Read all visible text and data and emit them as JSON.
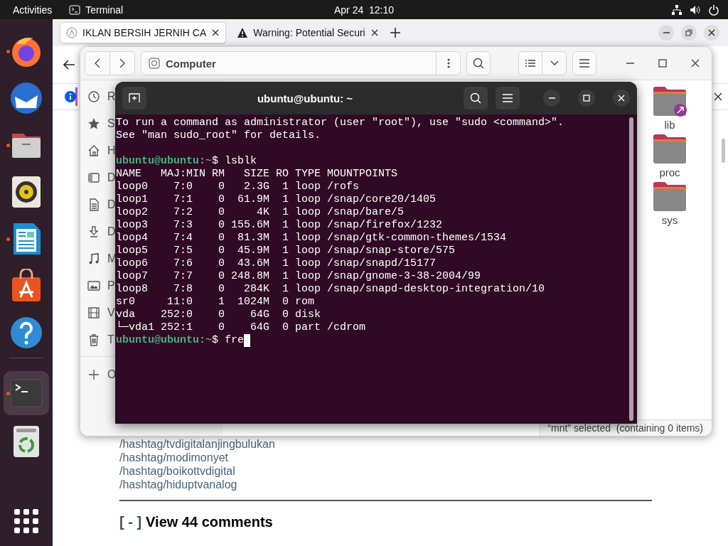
{
  "top_bar": {
    "activities": "Activities",
    "app_name": "Terminal",
    "clock": "Apr 24  12:10"
  },
  "dock": {
    "items": [
      {
        "kind": "firefox",
        "running": true,
        "selected": false
      },
      {
        "kind": "mail",
        "running": false,
        "selected": false
      },
      {
        "kind": "files",
        "running": true,
        "selected": false
      },
      {
        "kind": "music",
        "running": false,
        "selected": false
      },
      {
        "kind": "writer",
        "running": true,
        "selected": false
      },
      {
        "kind": "store",
        "running": false,
        "selected": false
      },
      {
        "kind": "help",
        "running": false,
        "selected": false
      },
      {
        "kind": "terminal",
        "running": true,
        "selected": true
      },
      {
        "kind": "trash",
        "running": false,
        "selected": false
      }
    ]
  },
  "browser": {
    "tabs": [
      {
        "title": "IKLAN BERSIH JERNIH CA",
        "kind": "page",
        "selected": true
      },
      {
        "title": "Warning: Potential Securi",
        "kind": "warning",
        "selected": false
      }
    ],
    "links": [
      "/hashtag/tvdigitalanjingbulukan",
      "/hashtag/modimonyet",
      "/hashtag/boikottvdigital",
      "/hashtag/hiduptvanalog"
    ],
    "comments_toggle": "[ - ]",
    "comments_label": "View 44 comments"
  },
  "files": {
    "location": "Computer",
    "sidebar": [
      {
        "label": "R",
        "kind": "recent"
      },
      {
        "label": "S",
        "kind": "starred"
      },
      {
        "label": "H",
        "kind": "home"
      },
      {
        "label": "D",
        "kind": "desktop"
      },
      {
        "label": "D",
        "kind": "documents"
      },
      {
        "label": "D",
        "kind": "downloads"
      },
      {
        "label": "M",
        "kind": "music"
      },
      {
        "label": "P",
        "kind": "pictures"
      },
      {
        "label": "V",
        "kind": "videos"
      },
      {
        "label": "T",
        "kind": "trash"
      },
      {
        "label": "O",
        "kind": "other"
      }
    ],
    "folders": [
      {
        "name": "lib",
        "link": true
      },
      {
        "name": "proc",
        "link": false
      },
      {
        "name": "sys",
        "link": false
      }
    ],
    "status": "“mnt” selected  (containing 0 items)"
  },
  "terminal": {
    "title": "ubuntu@ubuntu: ~",
    "lines": [
      {
        "kind": "text",
        "text": "To run a command as administrator (user \"root\"), use \"sudo <command>\"."
      },
      {
        "kind": "text",
        "text": "See \"man sudo_root\" for details."
      },
      {
        "kind": "blank"
      },
      {
        "kind": "prompt",
        "user": "ubuntu@ubuntu",
        "path": ":~",
        "command": "$ lsblk",
        "cursor": false
      },
      {
        "kind": "text",
        "text": "NAME   MAJ:MIN RM   SIZE RO TYPE MOUNTPOINTS"
      },
      {
        "kind": "text",
        "text": "loop0    7:0    0   2.3G  1 loop /rofs"
      },
      {
        "kind": "text",
        "text": "loop1    7:1    0  61.9M  1 loop /snap/core20/1405"
      },
      {
        "kind": "text",
        "text": "loop2    7:2    0     4K  1 loop /snap/bare/5"
      },
      {
        "kind": "text",
        "text": "loop3    7:3    0 155.6M  1 loop /snap/firefox/1232"
      },
      {
        "kind": "text",
        "text": "loop4    7:4    0  81.3M  1 loop /snap/gtk-common-themes/1534"
      },
      {
        "kind": "text",
        "text": "loop5    7:5    0  45.9M  1 loop /snap/snap-store/575"
      },
      {
        "kind": "text",
        "text": "loop6    7:6    0  43.6M  1 loop /snap/snapd/15177"
      },
      {
        "kind": "text",
        "text": "loop7    7:7    0 248.8M  1 loop /snap/gnome-3-38-2004/99"
      },
      {
        "kind": "text",
        "text": "loop8    7:8    0   284K  1 loop /snap/snapd-desktop-integration/10"
      },
      {
        "kind": "text",
        "text": "sr0     11:0    1  1024M  0 rom"
      },
      {
        "kind": "text",
        "text": "vda    252:0    0    64G  0 disk"
      },
      {
        "kind": "text",
        "text": "└─vda1 252:1    0    64G  0 part /cdrom"
      },
      {
        "kind": "prompt",
        "user": "ubuntu@ubuntu",
        "path": ":~",
        "command": "$ fre",
        "cursor": true
      }
    ]
  }
}
